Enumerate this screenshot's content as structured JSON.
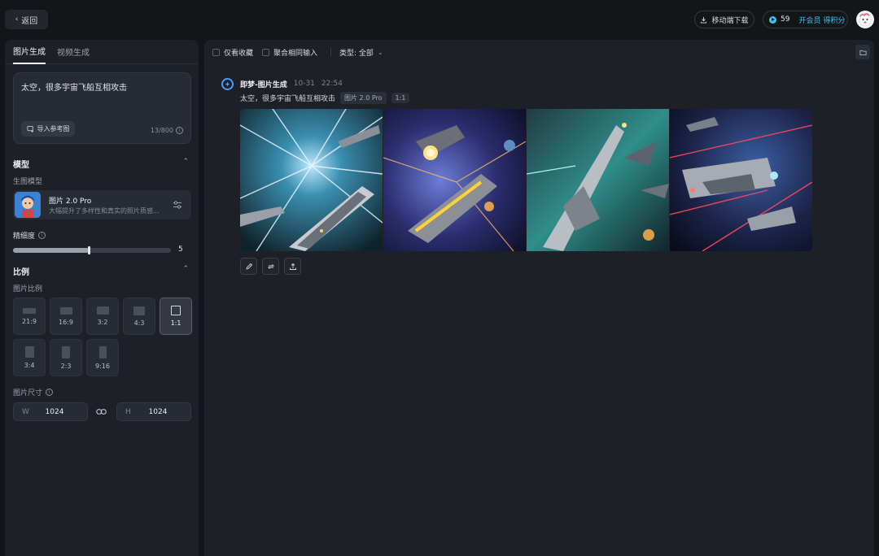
{
  "topbar": {
    "back_label": "返回",
    "download_label": "移动端下载",
    "credits": "59",
    "vip_label": "开会员 得积分"
  },
  "sidebar": {
    "tabs": [
      {
        "label": "图片生成"
      },
      {
        "label": "视频生成"
      }
    ],
    "prompt_text": "太空，很多宇宙飞船互相攻击",
    "ref_label": "导入参考图",
    "char_count": "13/800",
    "model_section": "模型",
    "model_sub": "生图模型",
    "model_name": "图片 2.0 Pro",
    "model_desc": "大幅提升了多样性和真实的照片质感...",
    "fineness_label": "精细度",
    "fineness_value": "5",
    "fineness_fraction": 0.48,
    "ratio_section": "比例",
    "ratio_sub": "图片比例",
    "ratios": [
      {
        "label": "21:9"
      },
      {
        "label": "16:9"
      },
      {
        "label": "3:2"
      },
      {
        "label": "4:3"
      },
      {
        "label": "1:1"
      },
      {
        "label": "3:4"
      },
      {
        "label": "2:3"
      },
      {
        "label": "9:16"
      }
    ],
    "active_ratio": "1:1",
    "size_label": "图片尺寸",
    "width_label": "W",
    "width_value": "1024",
    "height_label": "H",
    "height_value": "1024"
  },
  "main": {
    "filter_favorites": "仅看收藏",
    "filter_merge": "聚合相同输入",
    "filter_type": "类型: 全部",
    "result": {
      "source": "即梦-图片生成",
      "date": "10-31",
      "time": "22:54",
      "prompt": "太空，很多宇宙飞船互相攻击",
      "model_tag": "图片 2.0 Pro",
      "ratio_tag": "1:1"
    }
  },
  "colors": {
    "accent": "#35c8f0",
    "background": "#131519",
    "panel": "#1d2027"
  }
}
